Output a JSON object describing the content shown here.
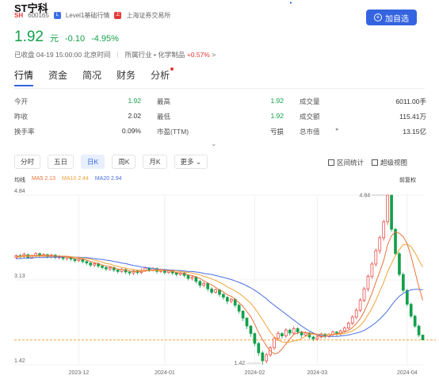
{
  "stock": {
    "name": "ST宁科",
    "market_badge": "SH",
    "code": "600165",
    "level_label": "Level1基础行情",
    "exchange_label": "上海证券交易所",
    "add_label": "加自选",
    "price": "1.92",
    "currency": "元",
    "change": "-0.10",
    "change_pct": "-4.95%",
    "status": "已收盘 04-19 15:00:00 北京时间",
    "industry_prefix": "所属行业",
    "industry_name": "化学制品",
    "industry_change": "+0.57%",
    "industry_chevron": ">"
  },
  "tabs": [
    "行情",
    "资金",
    "简况",
    "财务",
    "分析"
  ],
  "stats": [
    {
      "label": "今开",
      "value": "1.92",
      "green": true
    },
    {
      "label": "最高",
      "value": "1.92",
      "green": true
    },
    {
      "label": "成交量",
      "value": "6011.00手",
      "green": false
    },
    {
      "label": "昨收",
      "value": "2.02",
      "green": false
    },
    {
      "label": "最低",
      "value": "1.92",
      "green": true
    },
    {
      "label": "成交额",
      "value": "115.41万",
      "green": false
    },
    {
      "label": "换手率",
      "value": "0.09%",
      "green": false
    },
    {
      "label": "市盈(TTM)",
      "value": "亏损",
      "green": false
    },
    {
      "label": "总市值",
      "value": "13.15亿",
      "green": false
    }
  ],
  "periods": [
    "分时",
    "五日",
    "日K",
    "周K",
    "月K",
    "更多"
  ],
  "tools": {
    "range_stats": "区间统计",
    "super_view": "超级视图"
  },
  "ma": {
    "title": "均线",
    "ma5": "MA5 2.13",
    "ma10": "MA10 2.44",
    "ma20": "MA20 2.94",
    "adjust": "前复权"
  },
  "colors": {
    "up": "#e53935",
    "down": "#13a04a",
    "ma5": "#e8743b",
    "ma10": "#f2a33a",
    "ma20": "#4a6fe3",
    "accent": "#3464e0"
  },
  "chart_data": {
    "type": "candlestick",
    "y_ticks": [
      "4.84",
      "3.13",
      "1.42"
    ],
    "ylim": [
      1.42,
      4.84
    ],
    "x_ticks": [
      {
        "label": "2023-12",
        "index": 16
      },
      {
        "label": "2024-01",
        "index": 38
      },
      {
        "label": "2024-02",
        "index": 61
      },
      {
        "label": "2024-03",
        "index": 77
      },
      {
        "label": "2024-04",
        "index": 100
      }
    ],
    "max_label": "4.84",
    "min_label": "1.42",
    "ref_line": 1.92,
    "candles": [
      [
        3.58,
        3.62,
        3.64,
        3.55
      ],
      [
        3.62,
        3.6,
        3.66,
        3.56
      ],
      [
        3.6,
        3.65,
        3.68,
        3.57
      ],
      [
        3.64,
        3.58,
        3.66,
        3.55
      ],
      [
        3.58,
        3.62,
        3.64,
        3.55
      ],
      [
        3.62,
        3.66,
        3.69,
        3.59
      ],
      [
        3.66,
        3.61,
        3.68,
        3.58
      ],
      [
        3.61,
        3.64,
        3.67,
        3.58
      ],
      [
        3.64,
        3.59,
        3.66,
        3.56
      ],
      [
        3.59,
        3.63,
        3.66,
        3.56
      ],
      [
        3.63,
        3.58,
        3.65,
        3.55
      ],
      [
        3.58,
        3.6,
        3.63,
        3.54
      ],
      [
        3.6,
        3.56,
        3.62,
        3.52
      ],
      [
        3.56,
        3.59,
        3.61,
        3.52
      ],
      [
        3.59,
        3.55,
        3.61,
        3.51
      ],
      [
        3.55,
        3.52,
        3.57,
        3.48
      ],
      [
        3.52,
        3.55,
        3.58,
        3.49
      ],
      [
        3.55,
        3.5,
        3.57,
        3.46
      ],
      [
        3.5,
        3.47,
        3.52,
        3.43
      ],
      [
        3.47,
        3.43,
        3.49,
        3.39
      ],
      [
        3.43,
        3.46,
        3.49,
        3.39
      ],
      [
        3.46,
        3.41,
        3.48,
        3.37
      ],
      [
        3.41,
        3.38,
        3.44,
        3.34
      ],
      [
        3.38,
        3.35,
        3.41,
        3.31
      ],
      [
        3.35,
        3.38,
        3.41,
        3.31
      ],
      [
        3.38,
        3.33,
        3.4,
        3.29
      ],
      [
        3.33,
        3.3,
        3.35,
        3.26
      ],
      [
        3.3,
        3.34,
        3.37,
        3.27
      ],
      [
        3.34,
        3.29,
        3.36,
        3.25
      ],
      [
        3.29,
        3.27,
        3.31,
        3.22
      ],
      [
        3.27,
        3.31,
        3.34,
        3.23
      ],
      [
        3.31,
        3.28,
        3.33,
        3.24
      ],
      [
        3.28,
        3.32,
        3.36,
        3.25
      ],
      [
        3.32,
        3.37,
        3.4,
        3.29
      ],
      [
        3.37,
        3.33,
        3.39,
        3.29
      ],
      [
        3.33,
        3.36,
        3.39,
        3.3
      ],
      [
        3.36,
        3.3,
        3.38,
        3.26
      ],
      [
        3.3,
        3.33,
        3.36,
        3.27
      ],
      [
        3.33,
        3.28,
        3.35,
        3.24
      ],
      [
        3.28,
        3.31,
        3.34,
        3.25
      ],
      [
        3.31,
        3.27,
        3.33,
        3.23
      ],
      [
        3.27,
        3.24,
        3.29,
        3.2
      ],
      [
        3.24,
        3.27,
        3.3,
        3.21
      ],
      [
        3.27,
        3.22,
        3.29,
        3.18
      ],
      [
        3.22,
        3.16,
        3.24,
        3.12
      ],
      [
        3.16,
        3.19,
        3.22,
        3.12
      ],
      [
        3.19,
        3.1,
        3.21,
        3.06
      ],
      [
        3.1,
        3.02,
        3.13,
        2.97
      ],
      [
        3.02,
        3.06,
        3.09,
        2.98
      ],
      [
        3.06,
        2.95,
        3.08,
        2.9
      ],
      [
        2.95,
        2.88,
        2.98,
        2.84
      ],
      [
        2.88,
        2.93,
        2.96,
        2.85
      ],
      [
        2.93,
        2.84,
        2.95,
        2.79
      ],
      [
        2.84,
        2.78,
        2.87,
        2.73
      ],
      [
        2.78,
        2.7,
        2.8,
        2.64
      ],
      [
        2.7,
        2.74,
        2.77,
        2.66
      ],
      [
        2.74,
        2.62,
        2.76,
        2.57
      ],
      [
        2.62,
        2.5,
        2.65,
        2.45
      ],
      [
        2.5,
        2.36,
        2.52,
        2.3
      ],
      [
        2.36,
        2.2,
        2.38,
        2.14
      ],
      [
        2.2,
        2.05,
        2.22,
        1.98
      ],
      [
        2.05,
        1.85,
        2.07,
        1.8
      ],
      [
        1.85,
        1.66,
        1.88,
        1.6
      ],
      [
        1.66,
        1.5,
        1.7,
        1.42
      ],
      [
        1.5,
        1.62,
        1.66,
        1.45
      ],
      [
        1.62,
        1.76,
        1.8,
        1.58
      ],
      [
        1.76,
        1.95,
        1.99,
        1.72
      ],
      [
        1.95,
        2.05,
        2.1,
        1.9
      ],
      [
        2.05,
        2.0,
        2.08,
        1.95
      ],
      [
        2.0,
        2.12,
        2.16,
        1.96
      ],
      [
        2.12,
        2.06,
        2.15,
        2.01
      ],
      [
        2.06,
        2.15,
        2.19,
        2.02
      ],
      [
        2.15,
        2.08,
        2.18,
        2.03
      ],
      [
        2.08,
        2.02,
        2.11,
        1.97
      ],
      [
        2.02,
        2.06,
        2.09,
        1.98
      ],
      [
        2.06,
        1.98,
        2.08,
        1.94
      ],
      [
        1.98,
        1.94,
        2.01,
        1.9
      ],
      [
        1.94,
        1.98,
        2.01,
        1.91
      ],
      [
        1.98,
        2.04,
        2.07,
        1.95
      ],
      [
        2.04,
        1.99,
        2.06,
        1.95
      ],
      [
        1.99,
        2.03,
        2.06,
        1.96
      ],
      [
        2.03,
        2.08,
        2.11,
        2.0
      ],
      [
        2.08,
        2.04,
        2.1,
        2.0
      ],
      [
        2.04,
        2.1,
        2.13,
        2.01
      ],
      [
        2.1,
        2.16,
        2.19,
        2.07
      ],
      [
        2.16,
        2.26,
        2.29,
        2.13
      ],
      [
        2.26,
        2.38,
        2.42,
        2.22
      ],
      [
        2.38,
        2.52,
        2.56,
        2.34
      ],
      [
        2.52,
        2.72,
        2.76,
        2.48
      ],
      [
        2.72,
        2.95,
        2.99,
        2.68
      ],
      [
        2.95,
        3.2,
        3.24,
        2.9
      ],
      [
        3.2,
        3.45,
        3.49,
        3.15
      ],
      [
        3.45,
        3.72,
        3.76,
        3.4
      ],
      [
        3.72,
        3.98,
        4.02,
        3.66
      ],
      [
        3.98,
        4.3,
        4.34,
        3.92
      ],
      [
        4.3,
        4.84,
        4.84,
        4.24
      ],
      [
        4.84,
        4.15,
        4.84,
        4.1
      ],
      [
        4.15,
        3.66,
        4.18,
        3.62
      ],
      [
        3.66,
        3.24,
        3.7,
        3.2
      ],
      [
        3.24,
        2.92,
        3.28,
        2.88
      ],
      [
        2.92,
        2.64,
        2.95,
        2.6
      ],
      [
        2.64,
        2.4,
        2.67,
        2.36
      ],
      [
        2.4,
        2.2,
        2.43,
        2.16
      ],
      [
        2.2,
        2.02,
        2.23,
        1.98
      ],
      [
        2.02,
        1.92,
        2.02,
        1.92
      ]
    ],
    "ma5": [
      3.6,
      3.61,
      3.62,
      3.62,
      3.62,
      3.62,
      3.62,
      3.63,
      3.62,
      3.62,
      3.61,
      3.61,
      3.6,
      3.59,
      3.58,
      3.56,
      3.56,
      3.55,
      3.53,
      3.5,
      3.48,
      3.46,
      3.43,
      3.41,
      3.4,
      3.37,
      3.35,
      3.34,
      3.33,
      3.31,
      3.3,
      3.3,
      3.3,
      3.31,
      3.32,
      3.33,
      3.34,
      3.34,
      3.32,
      3.32,
      3.3,
      3.28,
      3.27,
      3.26,
      3.23,
      3.22,
      3.19,
      3.16,
      3.11,
      3.07,
      3.03,
      2.98,
      2.93,
      2.89,
      2.83,
      2.8,
      2.74,
      2.67,
      2.6,
      2.49,
      2.39,
      2.24,
      2.07,
      1.93,
      1.8,
      1.7,
      1.64,
      1.66,
      1.74,
      1.84,
      1.94,
      2.03,
      2.06,
      2.08,
      2.07,
      2.06,
      2.05,
      2.01,
      1.99,
      1.99,
      2.0,
      2.03,
      2.05,
      2.06,
      2.08,
      2.11,
      2.17,
      2.25,
      2.35,
      2.49,
      2.67,
      2.86,
      3.08,
      3.3,
      3.52,
      3.84,
      4.02,
      4.1,
      4.07,
      4.0,
      3.86,
      3.61,
      3.3,
      2.99,
      2.72
    ],
    "ma10": [
      3.59,
      3.6,
      3.6,
      3.61,
      3.61,
      3.61,
      3.61,
      3.61,
      3.61,
      3.61,
      3.61,
      3.61,
      3.61,
      3.61,
      3.6,
      3.59,
      3.58,
      3.57,
      3.56,
      3.55,
      3.53,
      3.51,
      3.49,
      3.46,
      3.45,
      3.42,
      3.4,
      3.38,
      3.37,
      3.35,
      3.34,
      3.33,
      3.32,
      3.32,
      3.32,
      3.32,
      3.32,
      3.32,
      3.32,
      3.32,
      3.32,
      3.31,
      3.3,
      3.29,
      3.28,
      3.27,
      3.25,
      3.23,
      3.2,
      3.18,
      3.15,
      3.12,
      3.08,
      3.04,
      2.99,
      2.95,
      2.91,
      2.86,
      2.8,
      2.73,
      2.66,
      2.56,
      2.45,
      2.33,
      2.2,
      2.08,
      1.98,
      1.92,
      1.88,
      1.87,
      1.88,
      1.9,
      1.91,
      1.95,
      1.99,
      2.03,
      2.04,
      2.04,
      2.03,
      2.03,
      2.03,
      2.03,
      2.03,
      2.04,
      2.05,
      2.07,
      2.1,
      2.15,
      2.21,
      2.3,
      2.43,
      2.56,
      2.72,
      2.9,
      3.08,
      3.29,
      3.46,
      3.62,
      3.74,
      3.84,
      3.85,
      3.8,
      3.68,
      3.53,
      3.39
    ],
    "ma20": [
      3.56,
      3.56,
      3.57,
      3.57,
      3.57,
      3.58,
      3.58,
      3.58,
      3.59,
      3.59,
      3.59,
      3.59,
      3.59,
      3.6,
      3.59,
      3.59,
      3.59,
      3.58,
      3.58,
      3.57,
      3.56,
      3.55,
      3.54,
      3.53,
      3.52,
      3.5,
      3.49,
      3.47,
      3.46,
      3.44,
      3.42,
      3.41,
      3.39,
      3.38,
      3.37,
      3.36,
      3.35,
      3.34,
      3.34,
      3.33,
      3.33,
      3.32,
      3.32,
      3.31,
      3.3,
      3.3,
      3.29,
      3.28,
      3.26,
      3.25,
      3.24,
      3.22,
      3.2,
      3.18,
      3.16,
      3.14,
      3.11,
      3.08,
      3.05,
      3.01,
      2.97,
      2.92,
      2.87,
      2.81,
      2.75,
      2.68,
      2.62,
      2.56,
      2.5,
      2.44,
      2.38,
      2.32,
      2.26,
      2.2,
      2.15,
      2.1,
      2.06,
      2.03,
      2.01,
      2.0,
      1.99,
      1.99,
      1.99,
      2.0,
      2.01,
      2.02,
      2.04,
      2.06,
      2.08,
      2.11,
      2.16,
      2.21,
      2.27,
      2.34,
      2.42,
      2.51,
      2.62,
      2.72,
      2.8,
      2.86,
      2.9,
      2.93,
      2.94,
      2.94,
      2.93
    ]
  }
}
